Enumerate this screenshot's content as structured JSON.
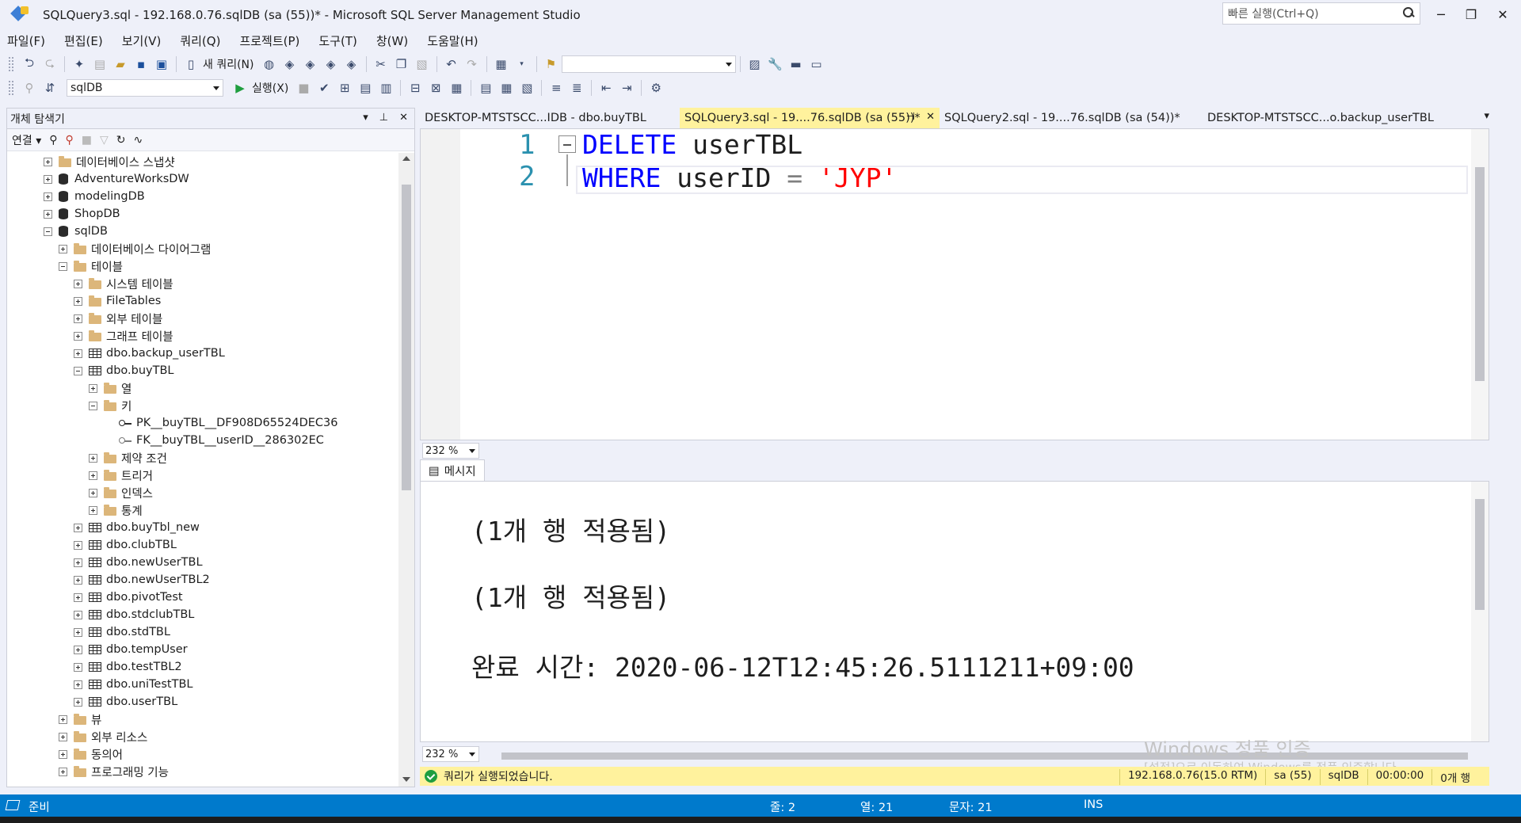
{
  "window": {
    "title": "SQLQuery3.sql - 192.168.0.76.sqlDB (sa (55))* - Microsoft SQL Server Management Studio",
    "quick_launch_placeholder": "빠른 실행(Ctrl+Q)",
    "minimize": "─",
    "maximize": "❐",
    "close": "✕"
  },
  "menu": [
    "파일(F)",
    "편집(E)",
    "보기(V)",
    "쿼리(Q)",
    "프로젝트(P)",
    "도구(T)",
    "창(W)",
    "도움말(H)"
  ],
  "toolbar1": {
    "new_query_label": "새 쿼리(N)",
    "solution_combo": ""
  },
  "toolbar2": {
    "database": "sqlDB",
    "execute_label": "실행(X)"
  },
  "object_explorer": {
    "title": "개체 탐색기",
    "connect_label": "연결",
    "tree": [
      {
        "label": "데이터베이스 스냅샷",
        "icon": "folder",
        "state": "plus",
        "indent": 0
      },
      {
        "label": "AdventureWorksDW",
        "icon": "db",
        "state": "plus",
        "indent": 0
      },
      {
        "label": "modelingDB",
        "icon": "db",
        "state": "plus",
        "indent": 0
      },
      {
        "label": "ShopDB",
        "icon": "db",
        "state": "plus",
        "indent": 0
      },
      {
        "label": "sqlDB",
        "icon": "db",
        "state": "minus",
        "indent": 0
      },
      {
        "label": "데이터베이스 다이어그램",
        "icon": "folder",
        "state": "plus",
        "indent": 1
      },
      {
        "label": "테이블",
        "icon": "folder",
        "state": "minus",
        "indent": 1
      },
      {
        "label": "시스템 테이블",
        "icon": "folder",
        "state": "plus",
        "indent": 2
      },
      {
        "label": "FileTables",
        "icon": "folder",
        "state": "plus",
        "indent": 2
      },
      {
        "label": "외부 테이블",
        "icon": "folder",
        "state": "plus",
        "indent": 2
      },
      {
        "label": "그래프 테이블",
        "icon": "folder",
        "state": "plus",
        "indent": 2
      },
      {
        "label": "dbo.backup_userTBL",
        "icon": "table",
        "state": "plus",
        "indent": 2
      },
      {
        "label": "dbo.buyTBL",
        "icon": "table",
        "state": "minus",
        "indent": 2
      },
      {
        "label": "열",
        "icon": "folder",
        "state": "plus",
        "indent": 3
      },
      {
        "label": "키",
        "icon": "folder",
        "state": "minus",
        "indent": 3
      },
      {
        "label": "PK__buyTBL__DF908D65524DEC36",
        "icon": "key",
        "state": "none",
        "indent": 4
      },
      {
        "label": "FK__buyTBL__userID__286302EC",
        "icon": "fkey",
        "state": "none",
        "indent": 4
      },
      {
        "label": "제약 조건",
        "icon": "folder",
        "state": "plus",
        "indent": 3
      },
      {
        "label": "트리거",
        "icon": "folder",
        "state": "plus",
        "indent": 3
      },
      {
        "label": "인덱스",
        "icon": "folder",
        "state": "plus",
        "indent": 3
      },
      {
        "label": "통계",
        "icon": "folder",
        "state": "plus",
        "indent": 3
      },
      {
        "label": "dbo.buyTbl_new",
        "icon": "table",
        "state": "plus",
        "indent": 2
      },
      {
        "label": "dbo.clubTBL",
        "icon": "table",
        "state": "plus",
        "indent": 2
      },
      {
        "label": "dbo.newUserTBL",
        "icon": "table",
        "state": "plus",
        "indent": 2
      },
      {
        "label": "dbo.newUserTBL2",
        "icon": "table",
        "state": "plus",
        "indent": 2
      },
      {
        "label": "dbo.pivotTest",
        "icon": "table",
        "state": "plus",
        "indent": 2
      },
      {
        "label": "dbo.stdclubTBL",
        "icon": "table",
        "state": "plus",
        "indent": 2
      },
      {
        "label": "dbo.stdTBL",
        "icon": "table",
        "state": "plus",
        "indent": 2
      },
      {
        "label": "dbo.tempUser",
        "icon": "table",
        "state": "plus",
        "indent": 2
      },
      {
        "label": "dbo.testTBL2",
        "icon": "table",
        "state": "plus",
        "indent": 2
      },
      {
        "label": "dbo.uniTestTBL",
        "icon": "table",
        "state": "plus",
        "indent": 2
      },
      {
        "label": "dbo.userTBL",
        "icon": "table",
        "state": "plus",
        "indent": 2
      },
      {
        "label": "뷰",
        "icon": "folder",
        "state": "plus",
        "indent": 1
      },
      {
        "label": "외부 리소스",
        "icon": "folder",
        "state": "plus",
        "indent": 1
      },
      {
        "label": "동의어",
        "icon": "folder",
        "state": "plus",
        "indent": 1
      },
      {
        "label": "프로그래밍 기능",
        "icon": "folder",
        "state": "plus",
        "indent": 1
      }
    ]
  },
  "tabs": [
    {
      "label": "DESKTOP-MTSTSCC...IDB - dbo.buyTBL",
      "active": false
    },
    {
      "label": "SQLQuery3.sql - 19....76.sqlDB (sa (55))*",
      "active": true
    },
    {
      "label": "SQLQuery2.sql - 19....76.sqlDB (sa (54))*",
      "active": false
    },
    {
      "label": "DESKTOP-MTSTSCC...o.backup_userTBL",
      "active": false
    }
  ],
  "editor": {
    "line_numbers": [
      "1",
      "2"
    ],
    "line1": {
      "kw1": "DELETE",
      "rest": " userTBL"
    },
    "line2": {
      "kw1": "WHERE",
      "ident": " userID ",
      "op": "=",
      "str": "'JYP'"
    },
    "zoom": "232 %"
  },
  "results": {
    "tab_label": "메시지",
    "lines": [
      "(1개 행 적용됨)",
      "(1개 행 적용됨)",
      "완료 시간: 2020-06-12T12:45:26.5111211+09:00"
    ],
    "zoom": "232 %"
  },
  "query_status": {
    "message": "쿼리가 실행되었습니다.",
    "server": "192.168.0.76(15.0 RTM)",
    "user": "sa (55)",
    "database": "sqlDB",
    "elapsed": "00:00:00",
    "rows": "0개 행"
  },
  "watermark": {
    "line1": "Windows 정품 인증",
    "line2": "[설정]으로 이동하여 Windows를 정품 인증합니다."
  },
  "statusbar": {
    "ready": "준비",
    "line": "줄: 2",
    "col": "열: 21",
    "ch": "문자: 21",
    "mode": "INS"
  },
  "colors": {
    "accent_blue": "#007acc",
    "active_tab": "#fff29d",
    "keyword": "#0000ff",
    "string": "#ff0000",
    "line_number": "#2b91af"
  }
}
